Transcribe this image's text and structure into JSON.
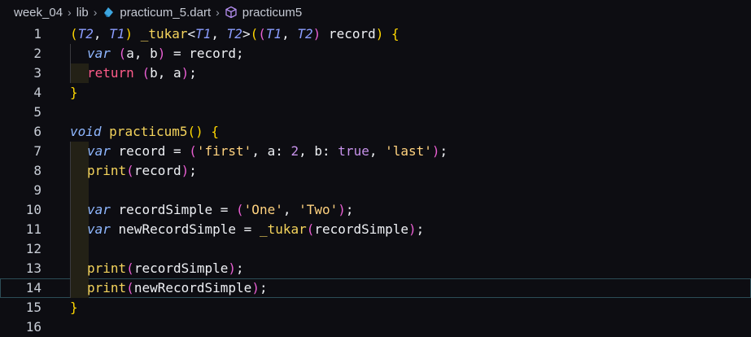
{
  "breadcrumb": {
    "items": [
      "week_04",
      "lib",
      "practicum_5.dart",
      "practicum5"
    ],
    "icons": [
      "chevron-right-icon",
      "dart-file-icon",
      "cube-symbol-icon"
    ]
  },
  "colors": {
    "background": "#0d0d12",
    "line_number": "#c8cdd6",
    "bracket_yellow": "#ffd700",
    "bracket_pink": "#ea5fd3",
    "bracket_blue": "#55a6ff",
    "type_param": "#8b9dff",
    "function": "#f5d45c",
    "keyword_control": "#ff5c8a",
    "keyword_var": "#8fb7ff",
    "string": "#ffd27f",
    "number": "#c792ea",
    "identifier": "#eef0f4"
  },
  "editor": {
    "current_line": 14,
    "lines": [
      {
        "n": "1",
        "tokens": [
          [
            "(",
            "#ffd700"
          ],
          [
            "T2",
            "#8b9dff",
            "i"
          ],
          [
            ", ",
            "#eef0f4"
          ],
          [
            "T1",
            "#8b9dff",
            "i"
          ],
          [
            ") ",
            "#ffd700"
          ],
          [
            "_tukar",
            "#f5d45c"
          ],
          [
            "<",
            "#eef0f4"
          ],
          [
            "T1",
            "#8b9dff",
            "i"
          ],
          [
            ", ",
            "#eef0f4"
          ],
          [
            "T2",
            "#8b9dff",
            "i"
          ],
          [
            ">",
            "#eef0f4"
          ],
          [
            "(",
            "#ffd700"
          ],
          [
            "(",
            "#ea5fd3"
          ],
          [
            "T1",
            "#8b9dff",
            "i"
          ],
          [
            ", ",
            "#eef0f4"
          ],
          [
            "T2",
            "#8b9dff",
            "i"
          ],
          [
            ")",
            "#ea5fd3"
          ],
          [
            " record",
            "#eef0f4"
          ],
          [
            ")",
            "#ffd700"
          ],
          [
            " {",
            "#ffd700"
          ]
        ]
      },
      {
        "n": "2",
        "tokens": [
          [
            "var",
            "#8fb7ff",
            "i"
          ],
          [
            " ",
            "#eef0f4"
          ],
          [
            "(",
            "#ea5fd3"
          ],
          [
            "a, b",
            "#eef0f4"
          ],
          [
            ")",
            "#ea5fd3"
          ],
          [
            " = record;",
            "#eef0f4"
          ]
        ]
      },
      {
        "n": "3",
        "tokens": [
          [
            "return",
            "#ff5c8a"
          ],
          [
            " ",
            "#eef0f4"
          ],
          [
            "(",
            "#ea5fd3"
          ],
          [
            "b, a",
            "#eef0f4"
          ],
          [
            ")",
            "#ea5fd3"
          ],
          [
            ";",
            "#eef0f4"
          ]
        ]
      },
      {
        "n": "4",
        "tokens": [
          [
            "}",
            "#ffd700"
          ]
        ]
      },
      {
        "n": "5",
        "tokens": []
      },
      {
        "n": "6",
        "tokens": [
          [
            "void",
            "#8fb7ff",
            "i"
          ],
          [
            " ",
            "#eef0f4"
          ],
          [
            "practicum5",
            "#f5d45c"
          ],
          [
            "()",
            "#ffd700"
          ],
          [
            " {",
            "#ffd700"
          ]
        ]
      },
      {
        "n": "7",
        "tokens": [
          [
            "var",
            "#8fb7ff",
            "i"
          ],
          [
            " record = ",
            "#eef0f4"
          ],
          [
            "(",
            "#ea5fd3"
          ],
          [
            "'first'",
            "#ffd27f"
          ],
          [
            ", a: ",
            "#eef0f4"
          ],
          [
            "2",
            "#c792ea"
          ],
          [
            ", b: ",
            "#eef0f4"
          ],
          [
            "true",
            "#c792ea"
          ],
          [
            ", ",
            "#eef0f4"
          ],
          [
            "'last'",
            "#ffd27f"
          ],
          [
            ")",
            "#ea5fd3"
          ],
          [
            ";",
            "#eef0f4"
          ]
        ]
      },
      {
        "n": "8",
        "tokens": [
          [
            "print",
            "#f5d45c"
          ],
          [
            "(",
            "#ea5fd3"
          ],
          [
            "record",
            "#eef0f4"
          ],
          [
            ")",
            "#ea5fd3"
          ],
          [
            ";",
            "#eef0f4"
          ]
        ]
      },
      {
        "n": "9",
        "tokens": []
      },
      {
        "n": "10",
        "tokens": [
          [
            "var",
            "#8fb7ff",
            "i"
          ],
          [
            " recordSimple = ",
            "#eef0f4"
          ],
          [
            "(",
            "#ea5fd3"
          ],
          [
            "'One'",
            "#ffd27f"
          ],
          [
            ", ",
            "#eef0f4"
          ],
          [
            "'Two'",
            "#ffd27f"
          ],
          [
            ")",
            "#ea5fd3"
          ],
          [
            ";",
            "#eef0f4"
          ]
        ]
      },
      {
        "n": "11",
        "tokens": [
          [
            "var",
            "#8fb7ff",
            "i"
          ],
          [
            " newRecordSimple = ",
            "#eef0f4"
          ],
          [
            "_tukar",
            "#f5d45c"
          ],
          [
            "(",
            "#ea5fd3"
          ],
          [
            "recordSimple",
            "#eef0f4"
          ],
          [
            ")",
            "#ea5fd3"
          ],
          [
            ";",
            "#eef0f4"
          ]
        ]
      },
      {
        "n": "12",
        "tokens": []
      },
      {
        "n": "13",
        "tokens": [
          [
            "print",
            "#f5d45c"
          ],
          [
            "(",
            "#ea5fd3"
          ],
          [
            "recordSimple",
            "#eef0f4"
          ],
          [
            ")",
            "#ea5fd3"
          ],
          [
            ";",
            "#eef0f4"
          ]
        ]
      },
      {
        "n": "14",
        "tokens": [
          [
            "print",
            "#f5d45c"
          ],
          [
            "(",
            "#ea5fd3"
          ],
          [
            "newRecordSimple",
            "#eef0f4"
          ],
          [
            ")",
            "#ea5fd3"
          ],
          [
            ";",
            "#eef0f4"
          ]
        ]
      },
      {
        "n": "15",
        "tokens": [
          [
            "}",
            "#ffd700"
          ]
        ]
      },
      {
        "n": "16",
        "tokens": []
      }
    ]
  }
}
